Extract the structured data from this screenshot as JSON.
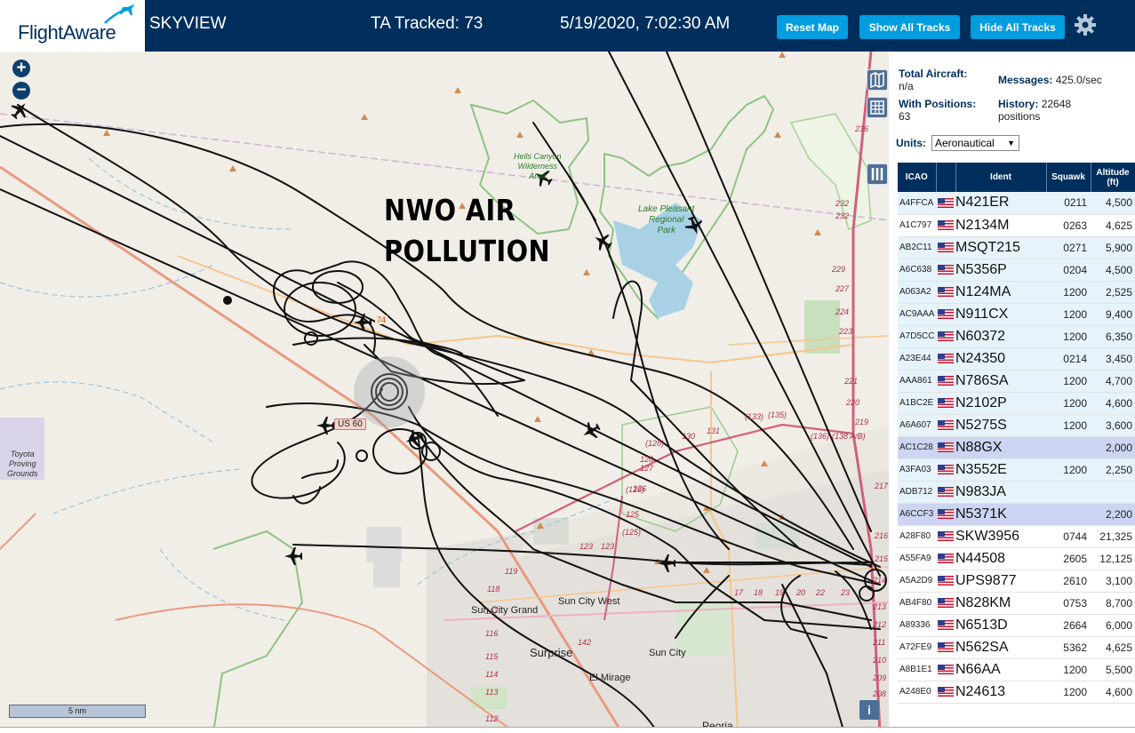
{
  "header": {
    "logo": "FlightAware",
    "app_name": "SKYVIEW",
    "ta_tracked": "TA Tracked: 73",
    "clock": "5/19/2020, 7:02:30 AM",
    "reset_map": "Reset Map",
    "show_all_tracks": "Show All Tracks",
    "hide_all_tracks": "Hide All Tracks",
    "settings_icon": "gear-icon"
  },
  "map": {
    "annotation_line1": "NWO AIR",
    "annotation_line2": "POLLUTION",
    "zoom_in": "+",
    "zoom_out": "−",
    "scale_label": "5 nm",
    "info": "i",
    "labels": {
      "hells_canyon": "Hells Canyon\nWilderness\nArea",
      "lake_pleasant": "Lake Pleasant\nRegional\nPark",
      "toyota": "Toyota\nProving\nGrounds",
      "sun_city_grand": "Sun City Grand",
      "sun_city_west": "Sun City West",
      "surprise": "Surprise",
      "sun_city": "Sun City",
      "el_mirage": "El Mirage",
      "peoria": "Peoria",
      "us60": "US 60",
      "r74": "74"
    },
    "route_numbers": [
      "232",
      "232",
      "236",
      "229",
      "227",
      "224",
      "223",
      "221",
      "220",
      "219",
      "217",
      "216",
      "215",
      "214",
      "213",
      "212",
      "211",
      "210",
      "209",
      "208",
      "131",
      "130",
      "128",
      "127",
      "126",
      "125",
      "123",
      "123",
      "119",
      "118",
      "117",
      "116",
      "115",
      "114",
      "113",
      "112",
      "17",
      "18",
      "19",
      "20",
      "22",
      "23",
      "(133)",
      "(135)",
      "(136)",
      "(138 A/B)",
      "(128)",
      "(126)",
      "(125)",
      "142"
    ],
    "tools": [
      "map-layers-icon",
      "grid-icon",
      "columns-icon"
    ]
  },
  "sidebar": {
    "total_aircraft_label": "Total Aircraft:",
    "total_aircraft_value": "n/a",
    "messages_label": "Messages:",
    "messages_value": "425.0/sec",
    "with_positions_label": "With Positions:",
    "with_positions_value": "63",
    "history_label": "History:",
    "history_value": "22648",
    "history_unit": "positions",
    "units_label": "Units:",
    "units_value": "Aeronautical",
    "columns": [
      "ICAO",
      "",
      "Ident",
      "Squawk",
      "Altitude (ft)"
    ],
    "rows": [
      {
        "icao": "A4FFCA",
        "ident": "N421ER",
        "squawk": "0211",
        "alt": "4,500",
        "style": "a"
      },
      {
        "icao": "A1C797",
        "ident": "N2134M",
        "squawk": "0263",
        "alt": "4,625",
        "style": "b"
      },
      {
        "icao": "AB2C11",
        "ident": "MSQT215",
        "squawk": "0271",
        "alt": "5,900",
        "style": "a"
      },
      {
        "icao": "A6C638",
        "ident": "N5356P",
        "squawk": "0204",
        "alt": "4,500",
        "style": "a"
      },
      {
        "icao": "A063A2",
        "ident": "N124MA",
        "squawk": "1200",
        "alt": "2,525",
        "style": "a"
      },
      {
        "icao": "AC9AAA",
        "ident": "N911CX",
        "squawk": "1200",
        "alt": "9,400",
        "style": "a"
      },
      {
        "icao": "A7D5CC",
        "ident": "N60372",
        "squawk": "1200",
        "alt": "6,350",
        "style": "a"
      },
      {
        "icao": "A23E44",
        "ident": "N24350",
        "squawk": "0214",
        "alt": "3,450",
        "style": "a"
      },
      {
        "icao": "AAA861",
        "ident": "N786SA",
        "squawk": "1200",
        "alt": "4,700",
        "style": "a"
      },
      {
        "icao": "A1BC2E",
        "ident": "N2102P",
        "squawk": "1200",
        "alt": "4,600",
        "style": "a"
      },
      {
        "icao": "A6A607",
        "ident": "N5275S",
        "squawk": "1200",
        "alt": "3,600",
        "style": "a"
      },
      {
        "icao": "AC1C28",
        "ident": "N88GX",
        "squawk": "",
        "alt": "2,000",
        "style": "sel"
      },
      {
        "icao": "A3FA03",
        "ident": "N3552E",
        "squawk": "1200",
        "alt": "2,250",
        "style": "a"
      },
      {
        "icao": "ADB712",
        "ident": "N983JA",
        "squawk": "",
        "alt": "",
        "style": "a"
      },
      {
        "icao": "A6CCF3",
        "ident": "N5371K",
        "squawk": "",
        "alt": "2,200",
        "style": "sel"
      },
      {
        "icao": "A28F80",
        "ident": "SKW3956",
        "squawk": "0744",
        "alt": "21,325",
        "style": "b"
      },
      {
        "icao": "A55FA9",
        "ident": "N44508",
        "squawk": "2605",
        "alt": "12,125",
        "style": "b"
      },
      {
        "icao": "A5A2D9",
        "ident": "UPS9877",
        "squawk": "2610",
        "alt": "3,100",
        "style": "b"
      },
      {
        "icao": "AB4F80",
        "ident": "N828KM",
        "squawk": "0753",
        "alt": "8,700",
        "style": "b"
      },
      {
        "icao": "A89336",
        "ident": "N6513D",
        "squawk": "2664",
        "alt": "6,000",
        "style": "b"
      },
      {
        "icao": "A72FE9",
        "ident": "N562SA",
        "squawk": "5362",
        "alt": "4,625",
        "style": "b"
      },
      {
        "icao": "A8B1E1",
        "ident": "N66AA",
        "squawk": "1200",
        "alt": "5,500",
        "style": "b"
      },
      {
        "icao": "A248E0",
        "ident": "N24613",
        "squawk": "1200",
        "alt": "4,600",
        "style": "b"
      }
    ]
  }
}
